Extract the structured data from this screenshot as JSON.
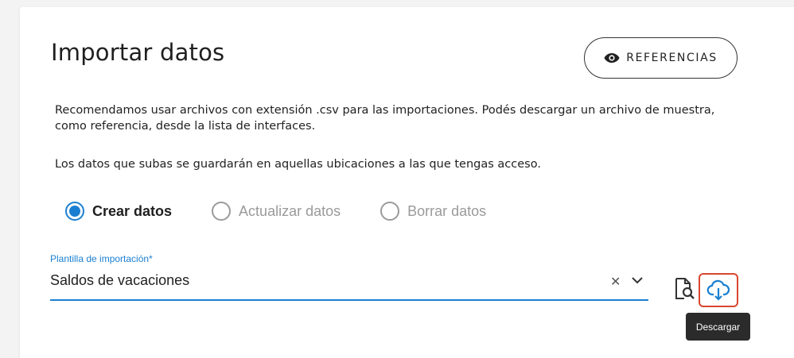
{
  "page": {
    "title": "Importar datos",
    "references_button": {
      "label": "REFERENCIAS",
      "icon": "eye-icon"
    },
    "description_1": "Recomendamos usar archivos con extensión .csv para las importaciones. Podés descargar un archivo de muestra, como referencia, desde la lista de interfaces.",
    "description_2": "Los datos que subas se guardarán en aquellas ubicaciones a las que tengas acceso."
  },
  "mode": {
    "options": [
      {
        "label": "Crear datos",
        "selected": true
      },
      {
        "label": "Actualizar datos",
        "selected": false
      },
      {
        "label": "Borrar datos",
        "selected": false
      }
    ]
  },
  "template_field": {
    "label": "Plantilla de importación*",
    "value": "Saldos de vacaciones"
  },
  "actions": {
    "preview_icon": "file-search-icon",
    "download_icon": "cloud-download-icon",
    "download_tooltip": "Descargar"
  },
  "colors": {
    "accent": "#1b7fd1",
    "highlight": "#d9462e",
    "tooltip_bg": "#2b2b2b"
  }
}
